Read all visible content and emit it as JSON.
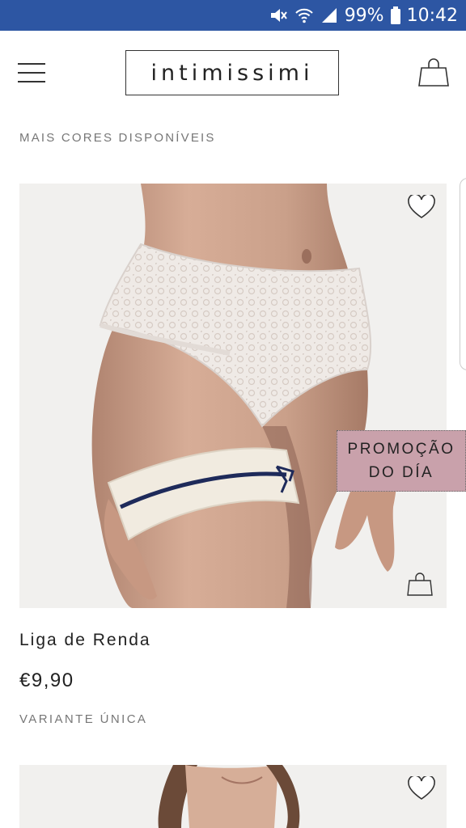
{
  "status_bar": {
    "battery": "99%",
    "time": "10:42"
  },
  "header": {
    "logo": "intimissimi"
  },
  "subtitle": "MAIS CORES DISPONÍVEIS",
  "product": {
    "name": "Liga de Renda",
    "price": "€9,90",
    "variant": "VARIANTE ÚNICA"
  },
  "promo": {
    "line1": "PROMOÇÃO",
    "line2": "DO DÍA"
  },
  "colors": {
    "status_bar": "#2d56a3",
    "promo_badge": "#c9a1ab",
    "garter_ribbon": "#1e2a5a"
  }
}
